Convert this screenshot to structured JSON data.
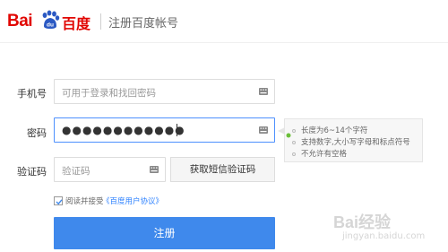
{
  "header": {
    "logo_text_latin": "Bai",
    "logo_text_paw": "du",
    "logo_text_cn": "百度",
    "page_title": "注册百度帐号"
  },
  "form": {
    "phone": {
      "label": "手机号",
      "placeholder": "可用于登录和找回密码"
    },
    "password": {
      "label": "密码",
      "value_masked": "●●●●●●●●●●●●"
    },
    "captcha": {
      "label": "验证码",
      "placeholder": "验证码",
      "sms_button": "获取短信验证码"
    },
    "agree": {
      "text": "阅读并接受",
      "link": "《百度用户协议》",
      "checked": true
    },
    "submit_label": "注册"
  },
  "password_tips": [
    "长度为6~14个字符",
    "支持数字,大小写字母和标点符号",
    "不允许有空格"
  ],
  "watermark": {
    "main": "Bai经验",
    "sub": "jingyan.baidu.com"
  },
  "colors": {
    "brand_red": "#e10602",
    "primary_blue": "#3f89ec",
    "focus_blue": "#4d90fe",
    "link_blue": "#2e82ff"
  }
}
